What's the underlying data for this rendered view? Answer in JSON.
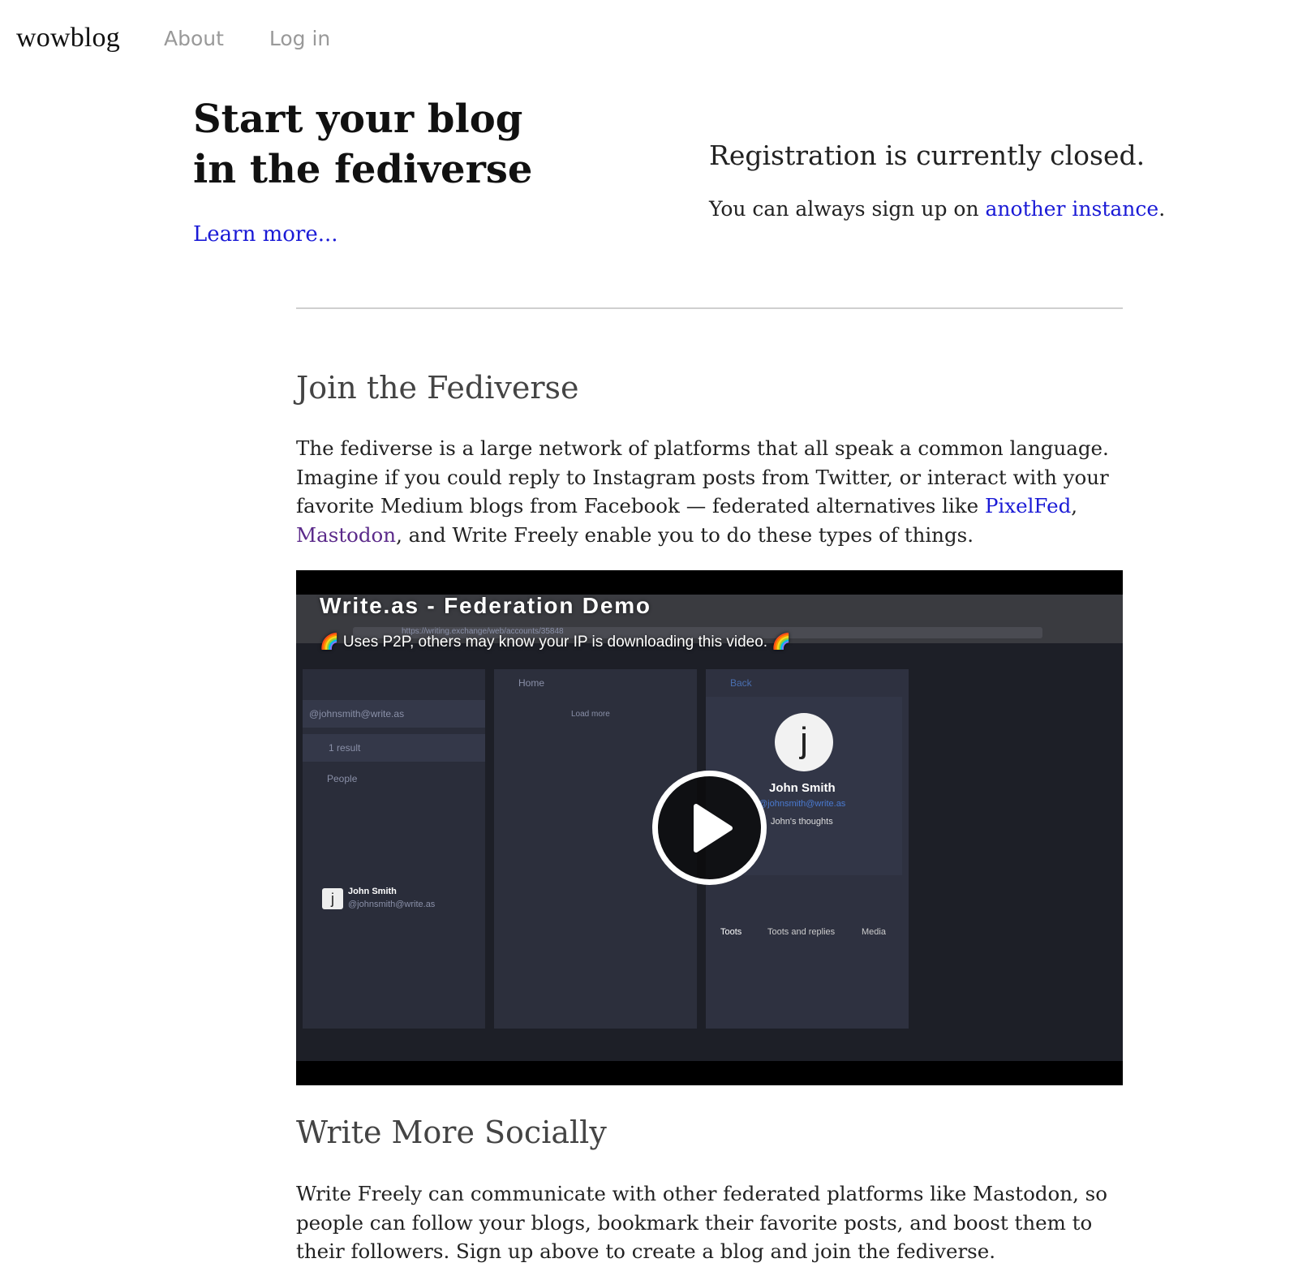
{
  "nav": {
    "brand": "wowblog",
    "links": [
      "About",
      "Log in"
    ]
  },
  "hero": {
    "title_line1": "Start your blog",
    "title_line2": "in the fediverse",
    "learn_more": "Learn more..."
  },
  "registration": {
    "closed": "Registration is currently closed.",
    "alt_prefix": "You can always sign up on ",
    "alt_link": "another instance",
    "alt_suffix": "."
  },
  "join": {
    "heading": "Join the Fediverse",
    "text_1": "The fediverse is a large network of platforms that all speak a common language. Imagine if you could reply to Instagram posts from Twitter, or interact with your favorite Medium blogs from Facebook — federated alternatives like ",
    "link_pixelfed": "PixelFed",
    "text_2": ", ",
    "link_mastodon": "Mastodon",
    "text_3": ", and Write Freely enable you to do these types of things."
  },
  "video": {
    "title": "Write.as - Federation Demo",
    "note": "🌈 Uses P2P, others may know your IP is downloading this video. 🌈",
    "url_text": "https://writing.exchange/web/accounts/35848",
    "account": "@johnsmith@write.as",
    "search_result": "1 result",
    "people": "People",
    "user_name": "John Smith",
    "user_handle": "@johnsmith@write.as",
    "home": "Home",
    "load_more": "Load more",
    "back": "Back",
    "bio": "John's thoughts",
    "toots_label": "Toots",
    "toots_replies": "Toots and replies",
    "media": "Media",
    "avatar_letter": "j"
  },
  "social": {
    "heading": "Write More Socially",
    "text": "Write Freely can communicate with other federated platforms like Mastodon, so people can follow your blogs, bookmark their favorite posts, and boost them to their followers. Sign up above to create a blog and join the fediverse."
  }
}
